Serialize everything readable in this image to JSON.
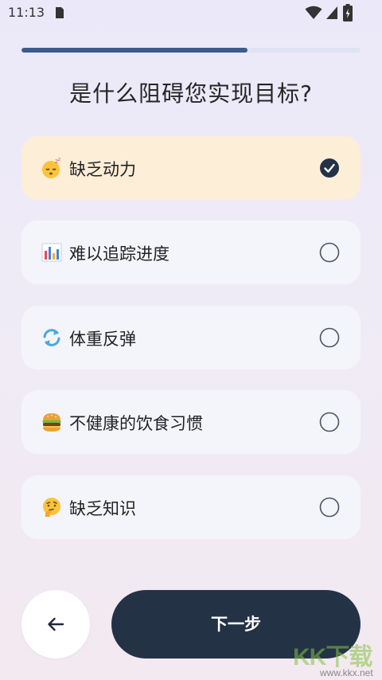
{
  "status_bar": {
    "time": "11:13",
    "icons": [
      "sim-card-icon",
      "wifi-icon",
      "signal-icon",
      "battery-icon"
    ]
  },
  "progress": {
    "value": 0.667
  },
  "title": "是什么阻碍您实现目标?",
  "options": [
    {
      "emoji": "sleepy-face-emoji",
      "label": "缺乏动力",
      "selected": true
    },
    {
      "emoji": "bar-chart-emoji",
      "label": "难以追踪进度",
      "selected": false
    },
    {
      "emoji": "repeat-arrows-emoji",
      "label": "体重反弹",
      "selected": false
    },
    {
      "emoji": "hamburger-emoji",
      "label": "不健康的饮食习惯",
      "selected": false
    },
    {
      "emoji": "thinking-face-emoji",
      "label": "缺乏知识",
      "selected": false
    }
  ],
  "buttons": {
    "back_icon": "arrow-left-icon",
    "next_label": "下一步"
  },
  "watermark": {
    "logo_text": "KK下载",
    "url": "www.kkx.net"
  },
  "colors": {
    "progress_fill": "#3b5c8c",
    "progress_track": "#dfe3f2",
    "selected_option_bg": "#fdeed8",
    "option_bg": "#f4f5fb",
    "primary_button": "#243246",
    "check_fill": "#243246"
  }
}
